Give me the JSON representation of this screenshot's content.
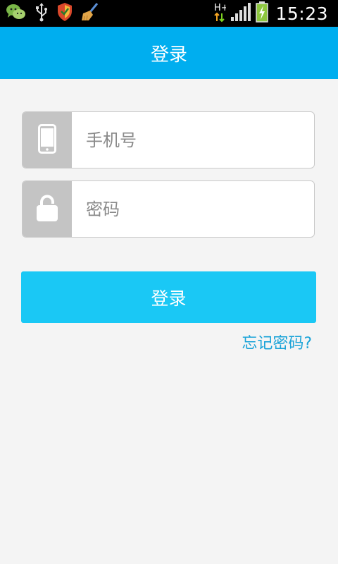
{
  "status_bar": {
    "time": "15:23",
    "network_label": "H+",
    "icons": [
      "wechat-icon",
      "usb-icon",
      "security-shield-icon",
      "cleaner-broom-icon",
      "data-transfer-icon",
      "signal-icon",
      "battery-charging-icon"
    ]
  },
  "header": {
    "title": "登录"
  },
  "form": {
    "phone_placeholder": "手机号",
    "password_placeholder": "密码",
    "phone_icon": "phone-icon",
    "password_icon": "lock-icon"
  },
  "actions": {
    "login_label": "登录",
    "forgot_password_label": "忘记密码?"
  },
  "colors": {
    "header": "#00aeef",
    "button": "#1ac8f5",
    "link": "#1aa3d8",
    "icon_bg": "#c4c4c4",
    "page_bg": "#f4f4f4"
  }
}
